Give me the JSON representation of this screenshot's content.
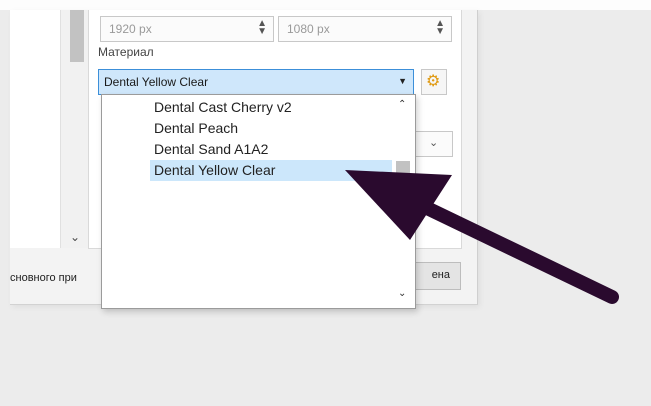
{
  "resolution": {
    "width": "1920 px",
    "height": "1080 px"
  },
  "material": {
    "label": "Материал",
    "selected": "Dental Yellow Clear",
    "options": [
      "Dental Cast Cherry v2",
      "Dental Peach",
      "Dental Sand A1A2",
      "Dental Yellow Clear"
    ]
  },
  "bottom_bar": {
    "left_text": "сновного при",
    "right_button": "ена"
  },
  "icons": {
    "gear": "gear-icon",
    "dropdown": "chevron-down-icon",
    "scroll_up": "chevron-up-icon",
    "scroll_down": "chevron-down-icon"
  },
  "colors": {
    "selection": "#cce7fb",
    "arrow": "#2a0a2e",
    "gear": "#e09a12"
  }
}
